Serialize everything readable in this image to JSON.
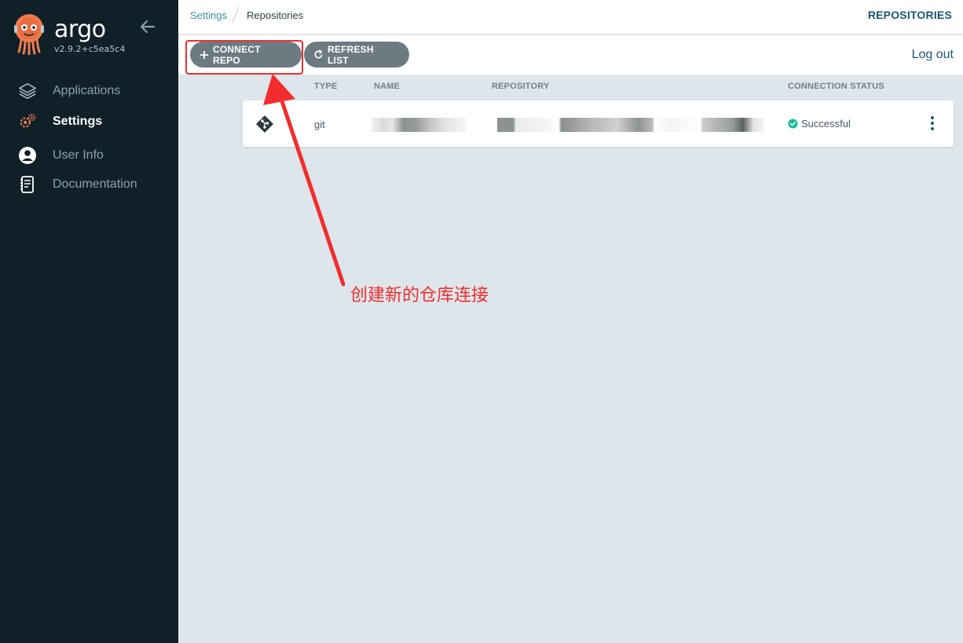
{
  "app": {
    "brand": "argo",
    "version": "v2.9.2+c5ea5c4"
  },
  "sidebar": {
    "items": [
      {
        "label": "Applications",
        "icon": "layers-icon",
        "active": false
      },
      {
        "label": "Settings",
        "icon": "gears-icon",
        "active": true
      },
      {
        "label": "User Info",
        "icon": "user-circle-icon",
        "active": false
      },
      {
        "label": "Documentation",
        "icon": "book-icon",
        "active": false
      }
    ]
  },
  "header": {
    "breadcrumb_parent": "Settings",
    "breadcrumb_current": "Repositories",
    "title": "REPOSITORIES"
  },
  "toolbar": {
    "connect_label": "CONNECT REPO",
    "refresh_label": "REFRESH LIST",
    "logout_label": "Log out"
  },
  "table": {
    "columns": [
      "TYPE",
      "NAME",
      "REPOSITORY",
      "CONNECTION STATUS"
    ],
    "rows": [
      {
        "type": "git",
        "name": "",
        "repository": "",
        "status": "Successful"
      }
    ]
  },
  "annotation": {
    "text": "创建新的仓库连接"
  },
  "colors": {
    "sidebar_bg": "#0f2029",
    "accent": "#1a5670",
    "button_bg": "#6c7a82",
    "success": "#18be94",
    "annotation_red": "#f22d2d",
    "logo_orange": "#ef7b4d"
  }
}
